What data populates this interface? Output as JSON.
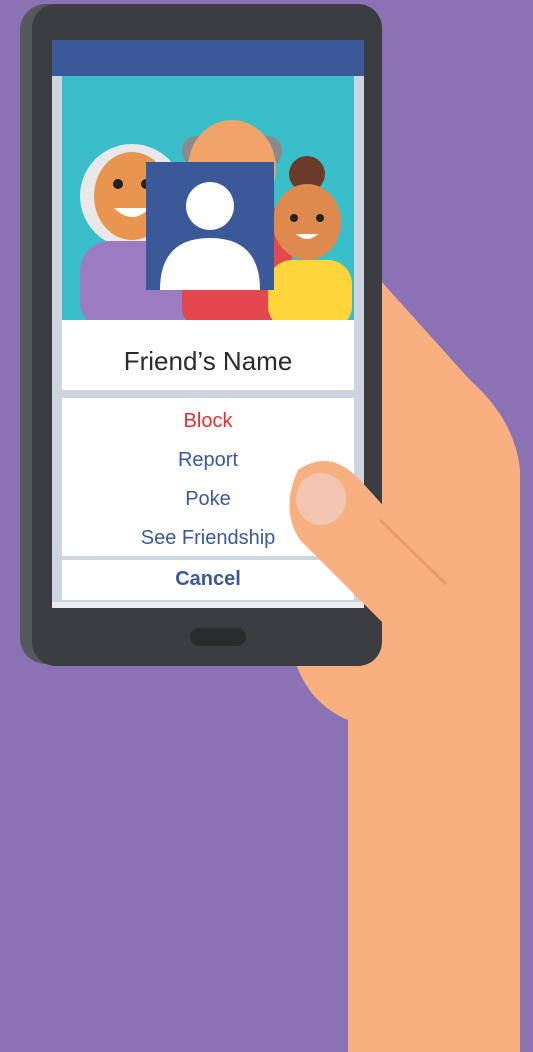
{
  "profile": {
    "friend_name": "Friend’s Name"
  },
  "menu": {
    "items": [
      {
        "label": "Block",
        "color": "#e0312c"
      },
      {
        "label": "Report",
        "color": "#3b5998"
      },
      {
        "label": "Poke",
        "color": "#3b5998"
      },
      {
        "label": "See Friendship",
        "color": "#3b5998"
      }
    ],
    "cancel_label": "Cancel"
  },
  "tabbar": {
    "tabs": [
      {
        "icon": "news-feed-icon",
        "active": true
      },
      {
        "icon": "friends-icon",
        "active": false
      },
      {
        "icon": "messages-icon",
        "active": false
      },
      {
        "icon": "globe-icon",
        "active": false
      },
      {
        "icon": "menu-icon",
        "active": false
      }
    ]
  },
  "colors": {
    "background": "#8b72b5",
    "brand": "#3b5998",
    "danger": "#e0312c",
    "skin": "#f8b080"
  }
}
